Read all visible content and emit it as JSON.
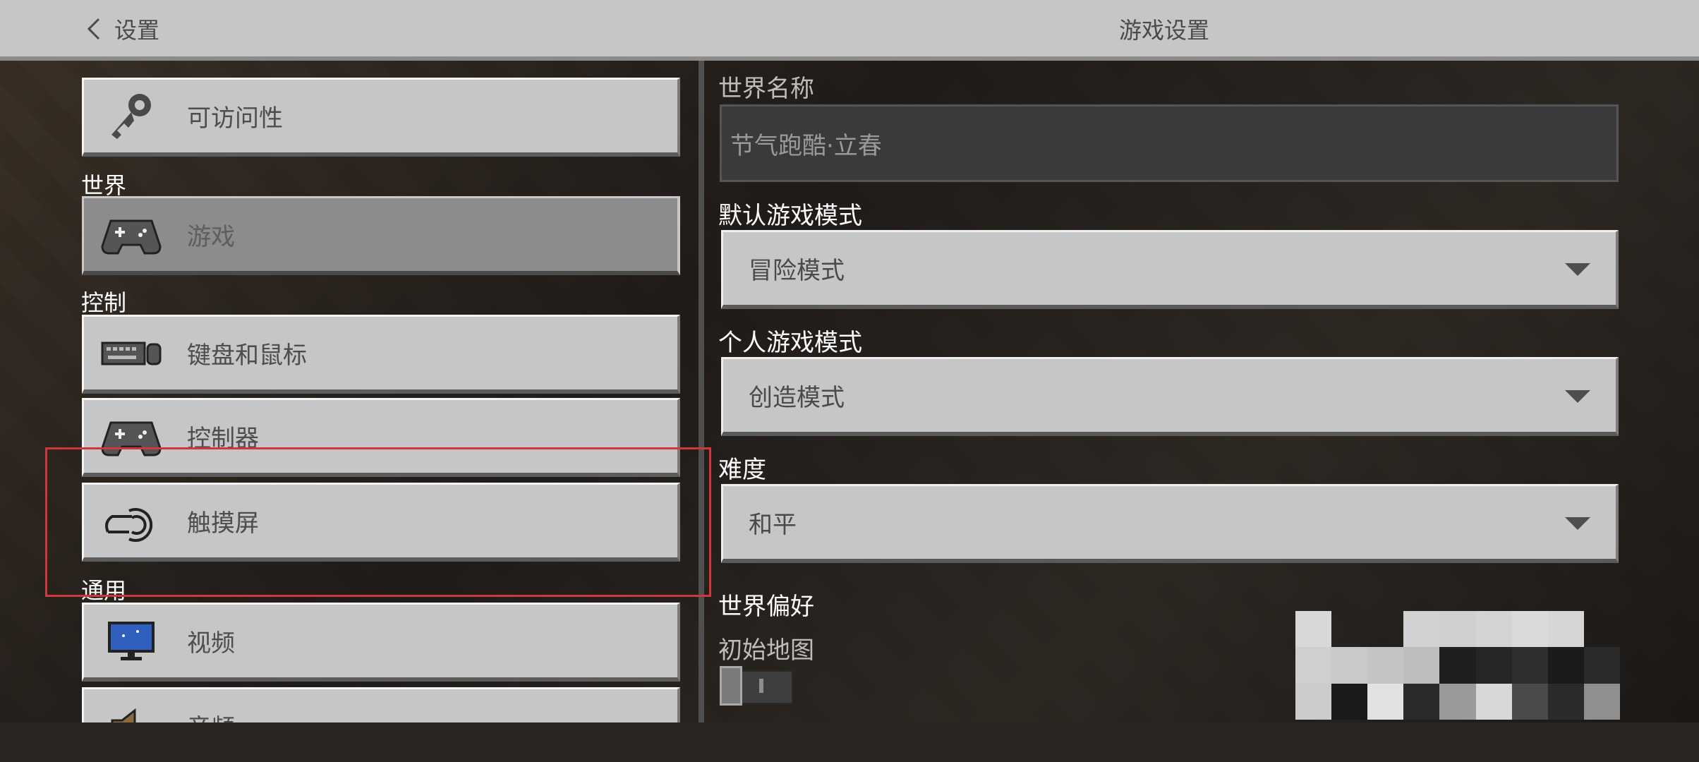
{
  "header": {
    "back_label": "设置",
    "title": "游戏设置"
  },
  "sidebar": {
    "sections": {
      "world": "世界",
      "controls": "控制",
      "general": "通用"
    },
    "items": [
      {
        "label": "可访问性",
        "icon": "key-icon"
      },
      {
        "label": "游戏",
        "icon": "gamepad-icon",
        "selected": true
      },
      {
        "label": "键盘和鼠标",
        "icon": "keyboard-mouse-icon"
      },
      {
        "label": "控制器",
        "icon": "controller-icon"
      },
      {
        "label": "触摸屏",
        "icon": "touch-icon"
      },
      {
        "label": "视频",
        "icon": "monitor-icon"
      },
      {
        "label": "音频",
        "icon": "speaker-icon"
      }
    ]
  },
  "settings": {
    "world_name_label": "世界名称",
    "world_name_value": "节气跑酷·立春",
    "default_mode_label": "默认游戏模式",
    "default_mode_value": "冒险模式",
    "personal_mode_label": "个人游戏模式",
    "personal_mode_value": "创造模式",
    "difficulty_label": "难度",
    "difficulty_value": "和平",
    "world_prefs_label": "世界偏好",
    "starting_map_label": "初始地图",
    "starting_map_enabled": false
  },
  "colors": {
    "panel": "#c6c6c6",
    "selected": "#8c8c8c",
    "highlight": "#d0373c",
    "header": "#c6c6c6"
  }
}
